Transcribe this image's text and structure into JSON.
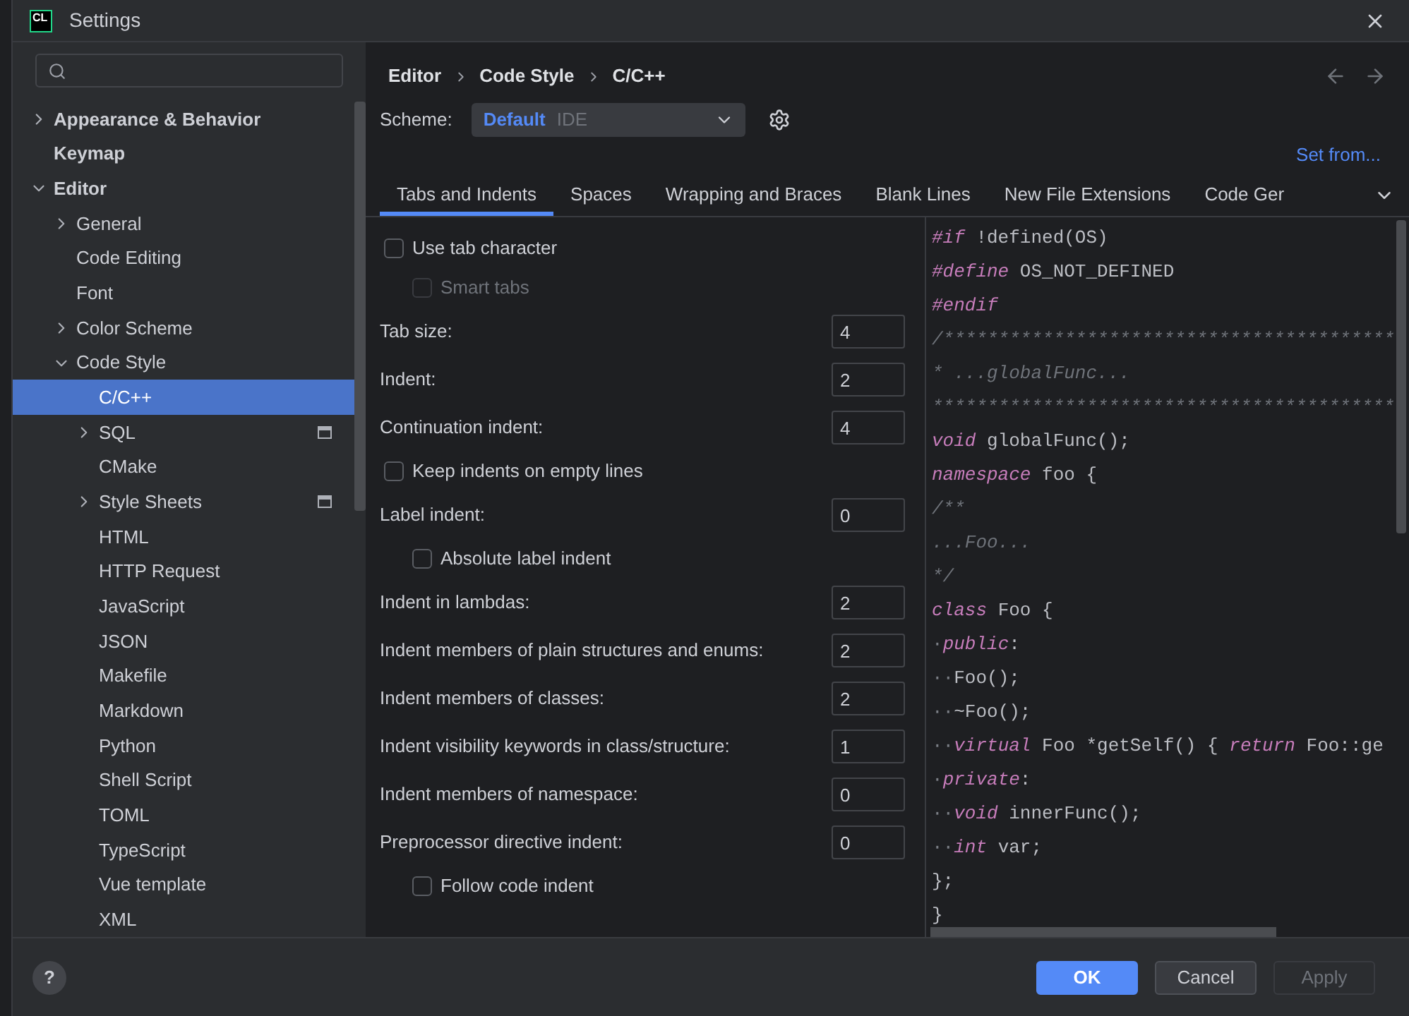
{
  "window": {
    "title": "Settings",
    "logo": "CL"
  },
  "sidebar": {
    "items": [
      {
        "label": "Appearance & Behavior",
        "expanded": false,
        "selected": false
      },
      {
        "label": "Keymap",
        "selected": false
      },
      {
        "label": "Editor",
        "expanded": true,
        "selected": false,
        "children": [
          {
            "label": "General",
            "expanded": false,
            "selected": false
          },
          {
            "label": "Code Editing",
            "selected": false
          },
          {
            "label": "Font",
            "selected": false
          },
          {
            "label": "Color Scheme",
            "expanded": false,
            "selected": false
          },
          {
            "label": "Code Style",
            "expanded": true,
            "selected": false,
            "children": [
              {
                "label": "C/C++",
                "selected": true,
                "badge": false
              },
              {
                "label": "SQL",
                "expanded": false,
                "selected": false,
                "badge": true
              },
              {
                "label": "CMake",
                "selected": false,
                "badge": false
              },
              {
                "label": "Style Sheets",
                "expanded": false,
                "selected": false,
                "badge": true
              },
              {
                "label": "HTML",
                "selected": false,
                "badge": false
              },
              {
                "label": "HTTP Request",
                "selected": false,
                "badge": false
              },
              {
                "label": "JavaScript",
                "selected": false,
                "badge": false
              },
              {
                "label": "JSON",
                "selected": false,
                "badge": false
              },
              {
                "label": "Makefile",
                "selected": false,
                "badge": false
              },
              {
                "label": "Markdown",
                "selected": false,
                "badge": false
              },
              {
                "label": "Python",
                "selected": false,
                "badge": false
              },
              {
                "label": "Shell Script",
                "selected": false,
                "badge": false
              },
              {
                "label": "TOML",
                "selected": false,
                "badge": false
              },
              {
                "label": "TypeScript",
                "selected": false,
                "badge": false
              },
              {
                "label": "Vue template",
                "selected": false,
                "badge": false
              },
              {
                "label": "XML",
                "selected": false,
                "badge": false
              }
            ]
          }
        ]
      }
    ]
  },
  "breadcrumb": [
    "Editor",
    "Code Style",
    "C/C++"
  ],
  "scheme": {
    "label": "Scheme:",
    "value": "Default",
    "hint": "IDE"
  },
  "set_from": "Set from...",
  "tabs": [
    {
      "label": "Tabs and Indents",
      "selected": true
    },
    {
      "label": "Spaces",
      "selected": false
    },
    {
      "label": "Wrapping and Braces",
      "selected": false
    },
    {
      "label": "Blank Lines",
      "selected": false
    },
    {
      "label": "New File Extensions",
      "selected": false
    },
    {
      "label": "Code Ger",
      "selected": false
    }
  ],
  "options": [
    {
      "kind": "checkbox",
      "label": "Use tab character",
      "checked": false,
      "nested": false,
      "disabled": false
    },
    {
      "kind": "checkbox",
      "label": "Smart tabs",
      "checked": false,
      "nested": true,
      "disabled": true
    },
    {
      "kind": "number",
      "label": "Tab size:",
      "value": "4"
    },
    {
      "kind": "number",
      "label": "Indent:",
      "value": "2"
    },
    {
      "kind": "number",
      "label": "Continuation indent:",
      "value": "4"
    },
    {
      "kind": "checkbox",
      "label": "Keep indents on empty lines",
      "checked": false,
      "nested": false,
      "disabled": false
    },
    {
      "kind": "number",
      "label": "Label indent:",
      "value": "0"
    },
    {
      "kind": "checkbox",
      "label": "Absolute label indent",
      "checked": false,
      "nested": true,
      "disabled": false
    },
    {
      "kind": "number",
      "label": "Indent in lambdas:",
      "value": "2"
    },
    {
      "kind": "number",
      "label": "Indent members of plain structures and enums:",
      "value": "2"
    },
    {
      "kind": "number",
      "label": "Indent members of classes:",
      "value": "2"
    },
    {
      "kind": "number",
      "label": "Indent visibility keywords in class/structure:",
      "value": "1"
    },
    {
      "kind": "number",
      "label": "Indent members of namespace:",
      "value": "0"
    },
    {
      "kind": "number",
      "label": "Preprocessor directive indent:",
      "value": "0"
    },
    {
      "kind": "checkbox",
      "label": "Follow code indent",
      "checked": false,
      "nested": true,
      "disabled": false
    }
  ],
  "code": [
    [
      {
        "kind": "keyword",
        "text": "#if"
      },
      {
        "kind": "plain",
        "text": " !defined(OS)"
      }
    ],
    [
      {
        "kind": "keyword",
        "text": "#define"
      },
      {
        "kind": "plain",
        "text": " OS_NOT_DEFINED"
      }
    ],
    [
      {
        "kind": "keyword",
        "text": "#endif"
      }
    ],
    [
      {
        "kind": "comment",
        "text": "/*****************************************"
      }
    ],
    [
      {
        "kind": "comment",
        "text": "* ...globalFunc..."
      }
    ],
    [
      {
        "kind": "comment",
        "text": "******************************************"
      }
    ],
    [
      {
        "kind": "keyword",
        "text": "void"
      },
      {
        "kind": "plain",
        "text": " globalFunc();"
      }
    ],
    [
      {
        "kind": "keyword",
        "text": "namespace"
      },
      {
        "kind": "plain",
        "text": " foo {"
      }
    ],
    [
      {
        "kind": "comment",
        "text": "/**"
      }
    ],
    [
      {
        "kind": "comment",
        "text": "...Foo..."
      }
    ],
    [
      {
        "kind": "comment",
        "text": "*/"
      }
    ],
    [
      {
        "kind": "keyword",
        "text": "class"
      },
      {
        "kind": "plain",
        "text": " Foo {"
      }
    ],
    [
      {
        "kind": "whitespace",
        "text": "·"
      },
      {
        "kind": "keyword",
        "text": "public"
      },
      {
        "kind": "plain",
        "text": ":"
      }
    ],
    [
      {
        "kind": "whitespace",
        "text": "··"
      },
      {
        "kind": "plain",
        "text": "Foo();"
      }
    ],
    [
      {
        "kind": "whitespace",
        "text": "··"
      },
      {
        "kind": "plain",
        "text": "~Foo();"
      }
    ],
    [
      {
        "kind": "whitespace",
        "text": "··"
      },
      {
        "kind": "keyword",
        "text": "virtual"
      },
      {
        "kind": "plain",
        "text": " Foo *getSelf() { "
      },
      {
        "kind": "keyword",
        "text": "return"
      },
      {
        "kind": "plain",
        "text": " Foo::ge"
      }
    ],
    [
      {
        "kind": "whitespace",
        "text": "·"
      },
      {
        "kind": "keyword",
        "text": "private"
      },
      {
        "kind": "plain",
        "text": ":"
      }
    ],
    [
      {
        "kind": "whitespace",
        "text": "··"
      },
      {
        "kind": "keyword",
        "text": "void"
      },
      {
        "kind": "plain",
        "text": " innerFunc();"
      }
    ],
    [
      {
        "kind": "whitespace",
        "text": "··"
      },
      {
        "kind": "keyword",
        "text": "int"
      },
      {
        "kind": "plain",
        "text": " var;"
      }
    ],
    [
      {
        "kind": "plain",
        "text": "};"
      }
    ],
    [
      {
        "kind": "plain",
        "text": "}"
      }
    ]
  ],
  "buttons": [
    {
      "label": "OK",
      "kind": "primary",
      "disabled": false
    },
    {
      "label": "Cancel",
      "kind": "secondary",
      "disabled": false
    },
    {
      "label": "Apply",
      "kind": "secondary",
      "disabled": true
    }
  ],
  "help": "?"
}
